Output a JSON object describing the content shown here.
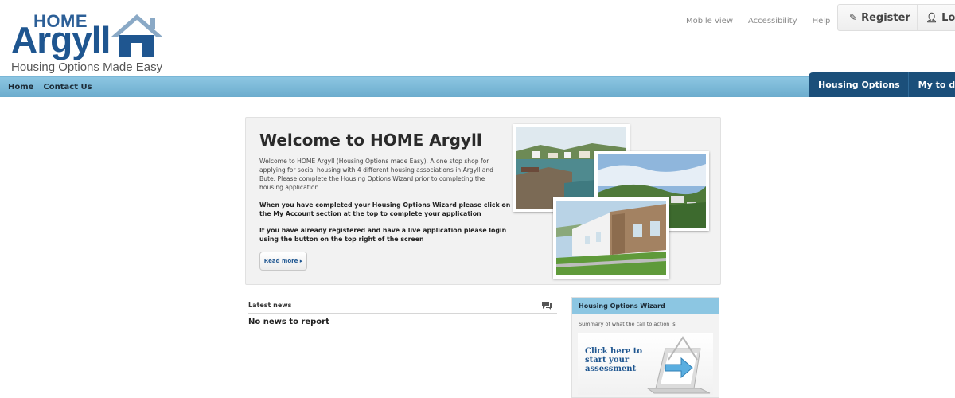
{
  "brand": {
    "home": "HOME",
    "name": "Argyll",
    "tagline": "Housing Options Made Easy",
    "color": "#1f5690"
  },
  "top_links": [
    "Mobile view",
    "Accessibility",
    "Help"
  ],
  "auth": {
    "register": "Register",
    "register_icon": "pencil-icon",
    "login": "Login",
    "login_icon": "user-icon"
  },
  "nav": {
    "left": [
      "Home",
      "Contact Us"
    ],
    "right": [
      "Housing Options",
      "My to do list"
    ],
    "bar_color": "#7fbcdc",
    "active_color": "#1b4f7a"
  },
  "welcome": {
    "title": "Welcome to HOME Argyll",
    "intro": "Welcome to HOME Argyll (Housing Options made Easy). A one stop shop for applying for social housing with 4 different housing associations in Argyll and Bute. Please complete the Housing Options Wizard prior to completing the housing application.",
    "bold_1": "When you have completed your Housing Options Wizard please click on the My Account section at the top to complete your application",
    "bold_2": "If you have already registered and have a live application please login using the button on the top right of the screen",
    "read_more": "Read more ▸"
  },
  "news": {
    "title": "Latest news",
    "icon": "chat-icon",
    "empty": "No news to report"
  },
  "wizard": {
    "title": "Housing Options Wizard",
    "summary": "Summary of what the call to action is",
    "cta_line1": "Click here to",
    "cta_line2": "start your",
    "cta_line3": "assessment"
  }
}
